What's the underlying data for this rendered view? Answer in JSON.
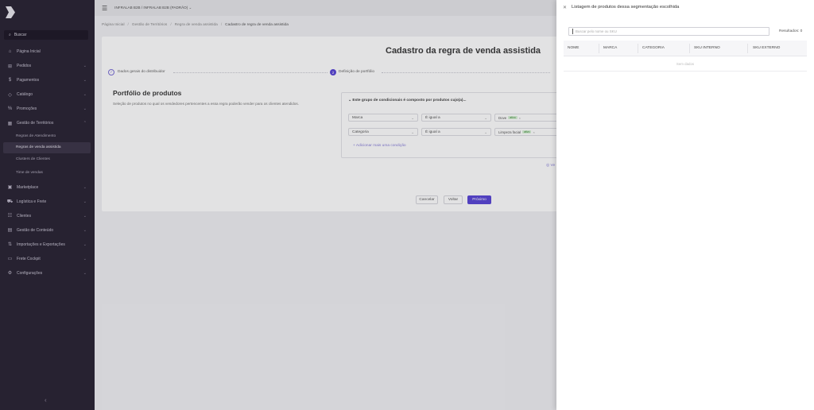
{
  "sidebar": {
    "search_label": "Buscar",
    "items": [
      {
        "label": "Página Inicial",
        "icon": "home-icon"
      },
      {
        "label": "Pedidos",
        "icon": "cart-icon"
      },
      {
        "label": "Pagamentos",
        "icon": "dollar-icon"
      },
      {
        "label": "Catálogo",
        "icon": "tag-icon"
      },
      {
        "label": "Promoções",
        "icon": "percent-icon"
      },
      {
        "label": "Gestão de Territórios",
        "icon": "grid-icon"
      }
    ],
    "subitems": [
      {
        "label": "Regras de Atendimento"
      },
      {
        "label": "Regras de venda assistida"
      },
      {
        "label": "Clusters de Clientes"
      },
      {
        "label": "Time de vendas"
      }
    ],
    "items_after": [
      {
        "label": "Marketplace",
        "icon": "store-icon"
      },
      {
        "label": "Logística e Frete",
        "icon": "truck-icon"
      },
      {
        "label": "Clientes",
        "icon": "users-icon"
      },
      {
        "label": "Gestão de Conteúdo",
        "icon": "file-icon"
      },
      {
        "label": "Importações e Exportações",
        "icon": "import-icon"
      },
      {
        "label": "Frete Cockpit",
        "icon": "cockpit-icon"
      },
      {
        "label": "Configurações",
        "icon": "gear-icon"
      }
    ]
  },
  "topbar": {
    "tenant_label": "INFRALAB B2B / INFRALAB B2B (PADRÃO) ⌄"
  },
  "breadcrumb": [
    "Página Inicial",
    "Gestão de Territórios",
    "Regra de venda assistida",
    "Cadastro de regra de venda assistida"
  ],
  "page": {
    "title": "Cadastro da regra de venda assistida",
    "steps": [
      {
        "label": "Dados gerais do distribuidor",
        "marker": "✓"
      },
      {
        "label": "Definição de portfólio",
        "marker": "2"
      }
    ],
    "section_title": "Portfólio de produtos",
    "section_desc": "Seleção de produtos no qual os vendedores pertencentes a essa regra poderão vender para os clientes atendidos.",
    "conditions_header": "Este grupo de condicionais é composto por produtos cujo(a)...",
    "conditions": [
      {
        "field": "Marca",
        "operator": "É igual a",
        "value": "Dove",
        "badge": "ativo"
      },
      {
        "field": "Categoria",
        "operator": "É igual a",
        "value": "Limpeza facial",
        "badge": "ativo"
      }
    ],
    "add_condition": "+ Adicionar mais uma condição",
    "side_link": "◎ Ve",
    "buttons": {
      "cancel": "Cancelar",
      "back": "Voltar",
      "next": "Próximo"
    }
  },
  "drawer": {
    "title": "Listagem de produtos dessa segmentação escolhida",
    "search_placeholder": "Buscar pelo nome ou SKU",
    "results_label": "Resultados: 0",
    "columns": [
      "NOME",
      "MARCA",
      "CATEGORIA",
      "SKU INTERNO",
      "SKU EXTERNO"
    ],
    "empty_text": "Sem dados"
  },
  "colors": {
    "sidebar_bg": "#2b2535",
    "accent": "#5b47d6",
    "badge_green": "#3a8a35"
  }
}
